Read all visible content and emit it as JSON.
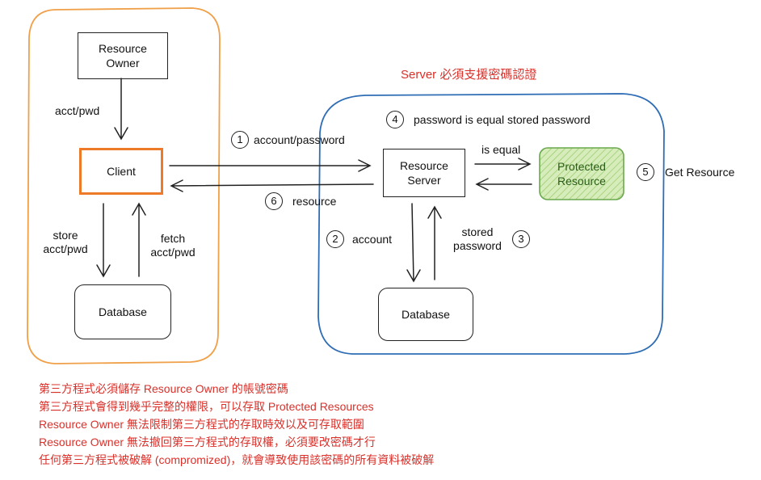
{
  "title": "Server 必須支援密碼認證",
  "nodes": {
    "resource_owner": "Resource\nOwner",
    "client": "Client",
    "client_database": "Database",
    "resource_server": "Resource\nServer",
    "protected_resource": "Protected\nResource",
    "server_database": "Database"
  },
  "labels": {
    "acct_pwd": "acct/pwd",
    "store_acct_pwd": "store\nacct/pwd",
    "fetch_acct_pwd": "fetch\nacct/pwd",
    "account_password": "account/password",
    "resource": "resource",
    "account": "account",
    "stored_password": "stored\npassword",
    "is_equal": "is equal",
    "password_equal": "password is equal stored password",
    "get_resource": "Get Resource"
  },
  "steps": [
    "1",
    "2",
    "3",
    "4",
    "5",
    "6"
  ],
  "notes": [
    "第三方程式必須儲存 Resource Owner 的帳號密碼",
    "第三方程式會得到幾乎完整的權限，可以存取 Protected Resources",
    "Resource Owner 無法限制第三方程式的存取時效以及可存取範圍",
    "Resource Owner 無法撤回第三方程式的存取權，必須要改密碼才行",
    "任何第三方程式被破解 (compromized)，就會導致使用該密碼的所有資料被破解"
  ],
  "colors": {
    "client_group": "#f0a048",
    "server_group": "#2f6db5",
    "client_box": "#ec7a28",
    "protected_fill": "#c9e6a6",
    "protected_border": "#6aa84f",
    "note_text": "#d9302a"
  }
}
